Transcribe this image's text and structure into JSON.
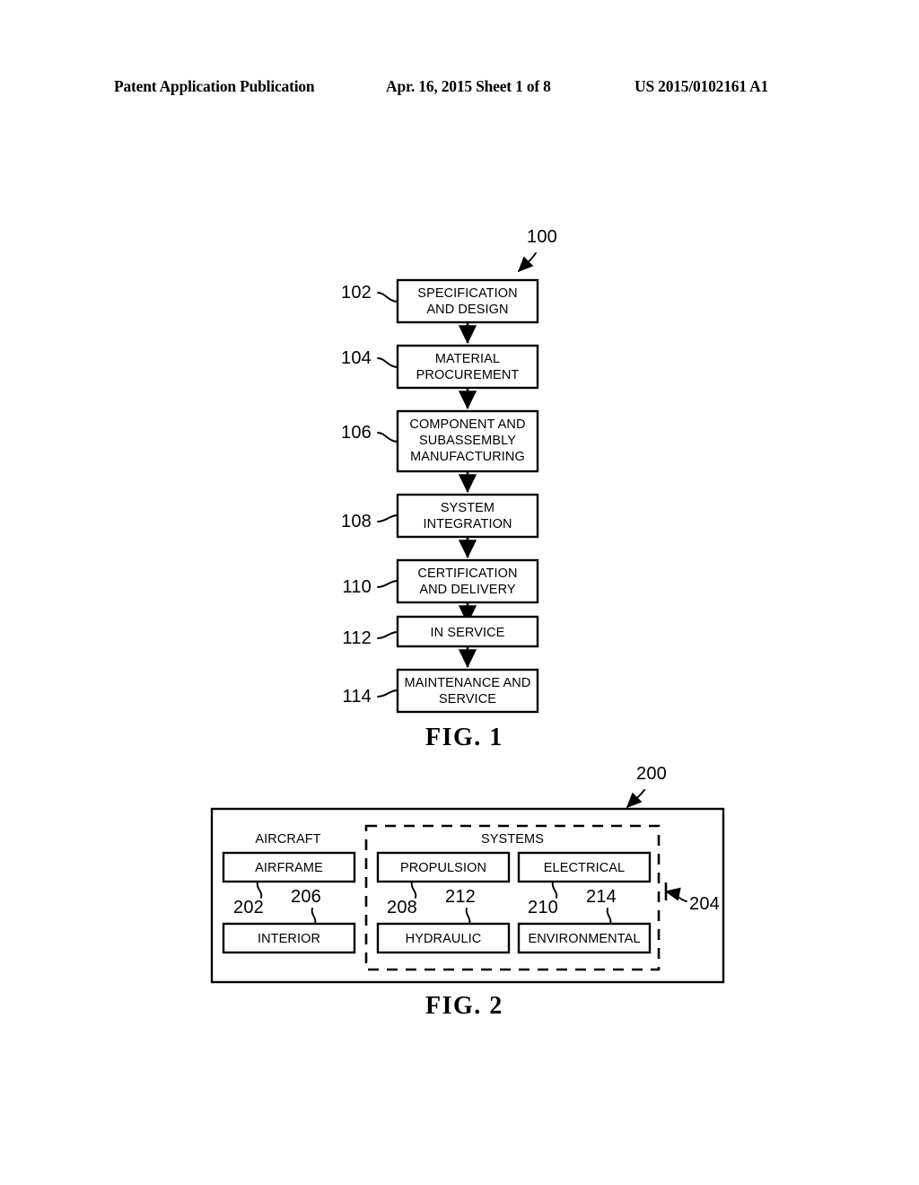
{
  "header": {
    "left": "Patent Application Publication",
    "middle": "Apr. 16, 2015  Sheet 1 of 8",
    "right": "US 2015/0102161 A1"
  },
  "figure1": {
    "caption": "FIG. 1",
    "diagram_ref": "100",
    "steps": [
      {
        "ref": "102",
        "lines": [
          "SPECIFICATION",
          "AND DESIGN"
        ]
      },
      {
        "ref": "104",
        "lines": [
          "MATERIAL",
          "PROCUREMENT"
        ]
      },
      {
        "ref": "106",
        "lines": [
          "COMPONENT AND",
          "SUBASSEMBLY",
          "MANUFACTURING"
        ]
      },
      {
        "ref": "108",
        "lines": [
          "SYSTEM",
          "INTEGRATION"
        ]
      },
      {
        "ref": "110",
        "lines": [
          "CERTIFICATION",
          "AND DELIVERY"
        ]
      },
      {
        "ref": "112",
        "lines": [
          "IN SERVICE"
        ]
      },
      {
        "ref": "114",
        "lines": [
          "MAINTENANCE AND",
          "SERVICE"
        ]
      }
    ]
  },
  "figure2": {
    "caption": "FIG. 2",
    "diagram_ref": "200",
    "aircraft_group_label": "AIRCRAFT",
    "systems_group_label": "SYSTEMS",
    "systems_group_ref": "204",
    "boxes": [
      {
        "ref": "202",
        "label": "AIRFRAME"
      },
      {
        "ref": "206",
        "label": "INTERIOR"
      },
      {
        "ref": "208",
        "label": "PROPULSION"
      },
      {
        "ref": "212",
        "label": "HYDRAULIC"
      },
      {
        "ref": "210",
        "label": "ELECTRICAL"
      },
      {
        "ref": "214",
        "label": "ENVIRONMENTAL"
      }
    ]
  },
  "colors": {
    "ink": "#000000",
    "paper": "#ffffff"
  }
}
